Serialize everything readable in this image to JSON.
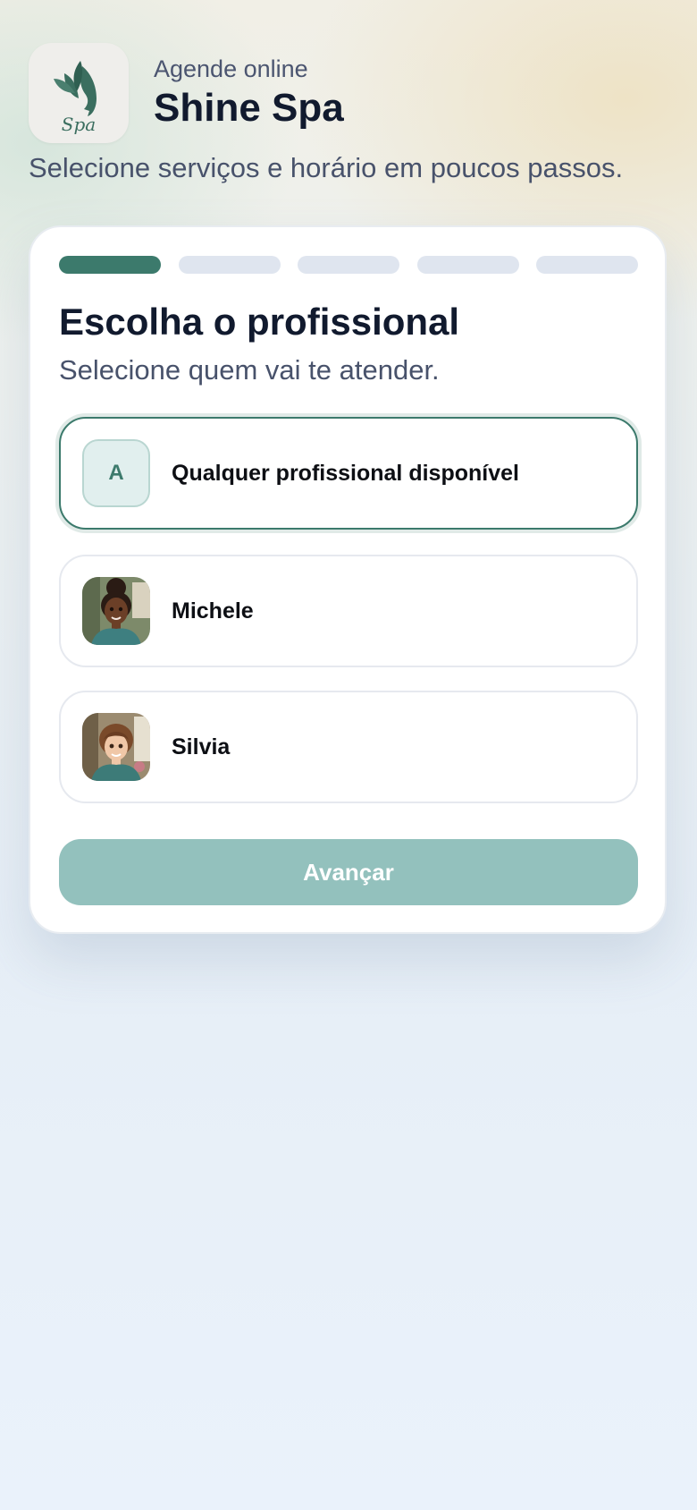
{
  "header": {
    "logo_icon": "spa-face-leaf-icon",
    "logo_text": "Spa",
    "eyebrow": "Agende online",
    "title": "Shine Spa"
  },
  "tagline": "Selecione serviços e horário em poucos passos.",
  "wizard": {
    "total_steps": 5,
    "current_step": 1,
    "title": "Escolha o profissional",
    "subtitle": "Selecione quem vai te atender."
  },
  "professionals": [
    {
      "initial": "A",
      "name": "Qualquer profissional disponível",
      "selected": true
    },
    {
      "avatar": "woman-avatar-curly-bun",
      "name": "Michele",
      "selected": false
    },
    {
      "avatar": "woman-avatar-brown-hair",
      "name": "Silvia",
      "selected": false
    }
  ],
  "next_button": {
    "label": "Avançar",
    "enabled": false
  },
  "colors": {
    "accent": "#3c7a6c",
    "button_disabled": "#93c1bd",
    "title_text": "#111a2e",
    "muted_text": "#48526b"
  }
}
